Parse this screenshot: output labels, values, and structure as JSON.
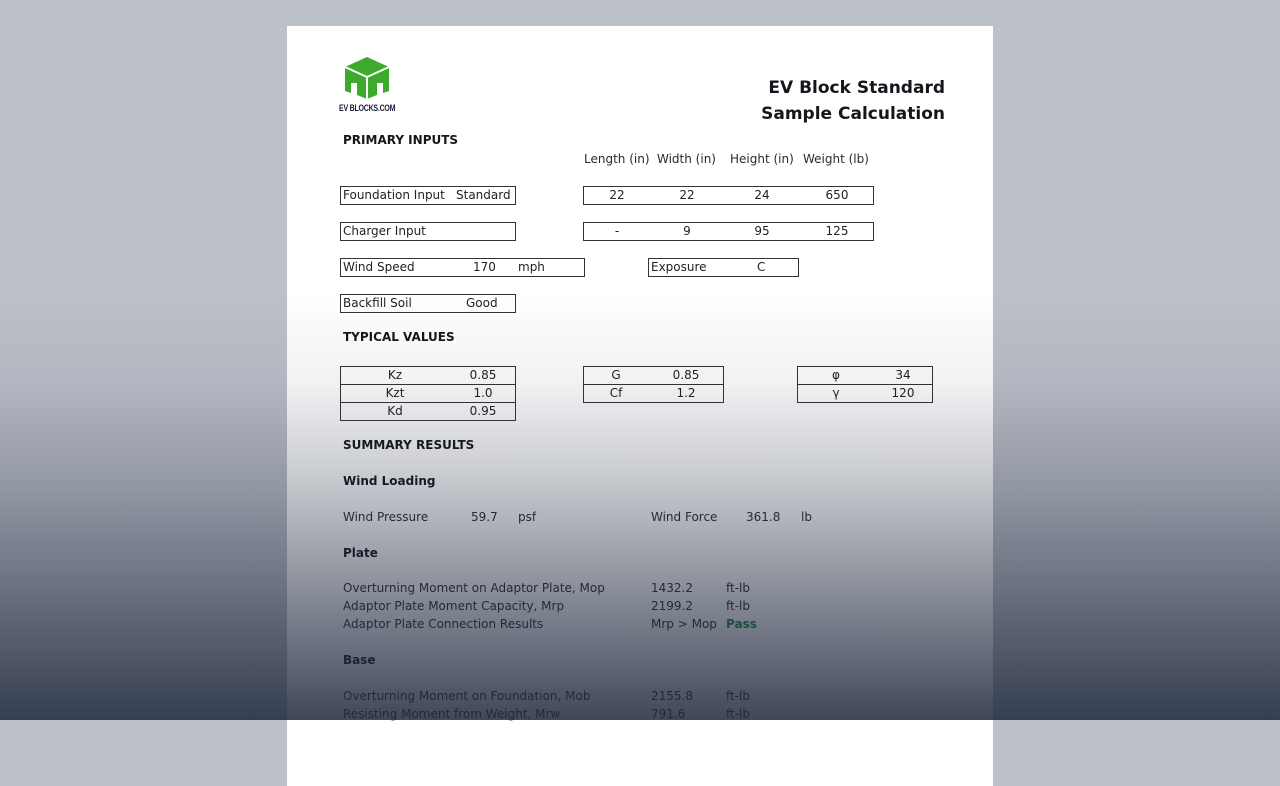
{
  "header": {
    "logo_text": "EV BLOCKS.COM",
    "brand_color": "#3cab2c",
    "title_line1": "EV Block Standard",
    "title_line2": "Sample Calculation"
  },
  "primary_inputs": {
    "heading": "PRIMARY INPUTS",
    "columns": [
      "Length (in)",
      "Width (in)",
      "Height (in)",
      "Weight (lb)"
    ],
    "foundation": {
      "label": "Foundation Input",
      "value": "Standard",
      "dims": [
        "22",
        "22",
        "24",
        "650"
      ]
    },
    "charger": {
      "label": "Charger Input",
      "value": "",
      "dims": [
        "-",
        "9",
        "95",
        "125"
      ]
    },
    "wind_speed": {
      "label": "Wind Speed",
      "value": "170",
      "unit": "mph"
    },
    "exposure": {
      "label": "Exposure",
      "value": "C"
    },
    "backfill": {
      "label": "Backfill Soil",
      "value": "Good"
    }
  },
  "typical_values": {
    "heading": "TYPICAL VALUES",
    "group1": [
      {
        "name": "Kz",
        "value": "0.85"
      },
      {
        "name": "Kzt",
        "value": "1.0"
      },
      {
        "name": "Kd",
        "value": "0.95"
      }
    ],
    "group2": [
      {
        "name": "G",
        "value": "0.85"
      },
      {
        "name": "Cf",
        "value": "1.2"
      }
    ],
    "group3": [
      {
        "name": "φ",
        "value": "34"
      },
      {
        "name": "γ",
        "value": "120"
      }
    ]
  },
  "summary": {
    "heading": "SUMMARY RESULTS",
    "wind_loading": {
      "heading": "Wind Loading",
      "pressure_label": "Wind Pressure",
      "pressure_value": "59.7",
      "pressure_unit": "psf",
      "force_label": "Wind Force",
      "force_value": "361.8",
      "force_unit": "lb"
    },
    "plate": {
      "heading": "Plate",
      "rows": [
        {
          "label": "Overturning Moment on Adaptor Plate, Mop",
          "value": "1432.2",
          "unit": "ft-lb"
        },
        {
          "label": "Adaptor Plate Moment Capacity, Mrp",
          "value": "2199.2",
          "unit": "ft-lb"
        },
        {
          "label": "Adaptor Plate Connection Results",
          "value": "Mrp > Mop",
          "unit": "Pass"
        }
      ],
      "pass_color": "#1d8a3a"
    },
    "base": {
      "heading": "Base",
      "rows": [
        {
          "label": "Overturning Moment on Foundation, Mob",
          "value": "2155.8",
          "unit": "ft-lb"
        },
        {
          "label": "Resisting Moment from Weight, Mrw",
          "value": "791.6",
          "unit": "ft-lb"
        }
      ]
    }
  }
}
